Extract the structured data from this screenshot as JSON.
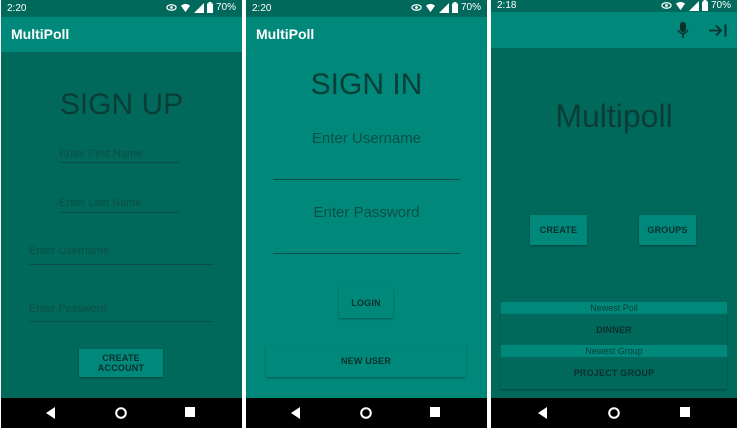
{
  "colors": {
    "status": "#00695c",
    "appbar": "#00897b",
    "bg_dark": "#00695c",
    "bg_teal": "#00897b",
    "text_dark": "#0b3d37"
  },
  "screen1": {
    "status": {
      "time": "2:20",
      "battery": "70%"
    },
    "app_title": "MultiPoll",
    "heading": "SIGN UP",
    "first_name_placeholder": "Enter First Name",
    "last_name_placeholder": "Enter Last Name",
    "username_placeholder": "Enter Username",
    "password_placeholder": "Enter Password",
    "create_account_label": "CREATE ACCOUNT"
  },
  "screen2": {
    "status": {
      "time": "2:20",
      "battery": "70%"
    },
    "app_title": "MultiPoll",
    "heading": "SIGN IN",
    "username_placeholder": "Enter Username",
    "password_placeholder": "Enter Password",
    "login_label": "LOGIN",
    "new_user_label": "NEW USER"
  },
  "screen3": {
    "status": {
      "time": "2:18",
      "battery": "70%"
    },
    "heading": "Multipoll",
    "create_label": "CREATE",
    "groups_label": "GROUPS",
    "newest_poll_label": "Newest Poll",
    "newest_poll_value": "DINNER",
    "newest_group_label": "Newest Group",
    "newest_group_value": "PROJECT GROUP"
  }
}
